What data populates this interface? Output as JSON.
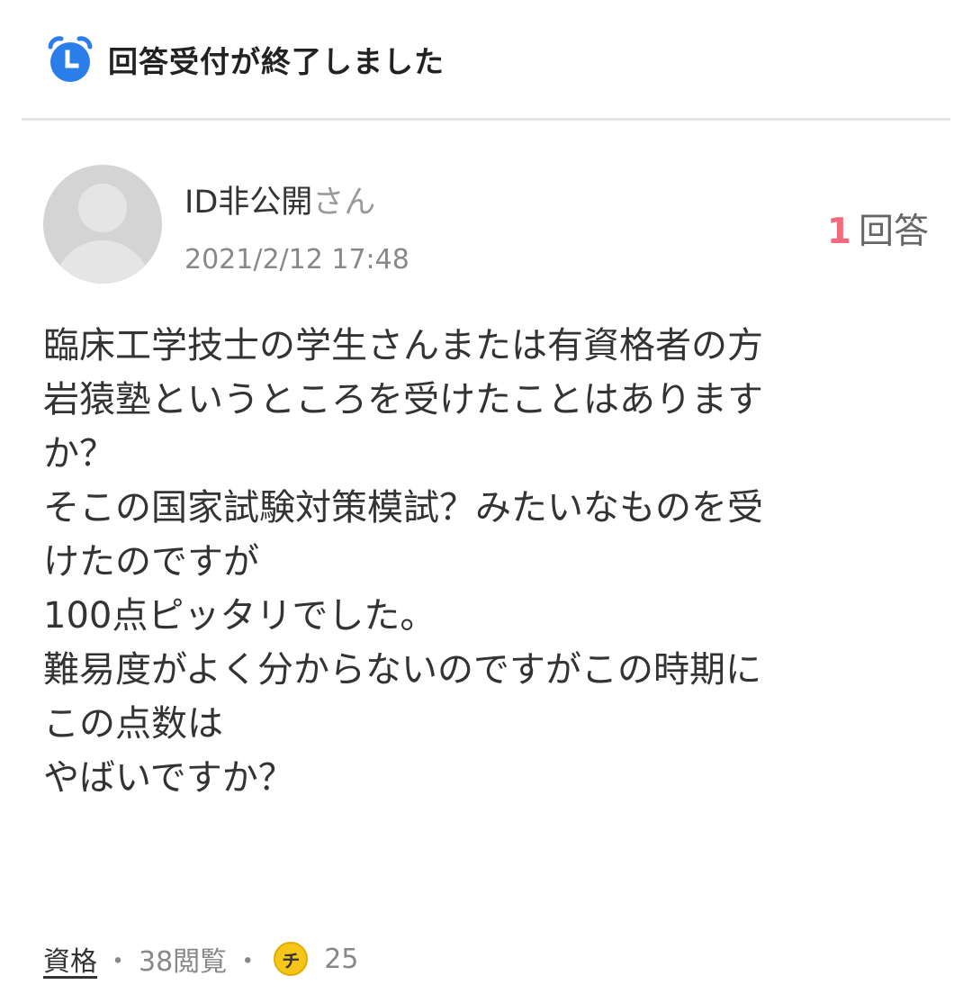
{
  "status": {
    "icon": "alarm-clock-icon",
    "text": "回答受付が終了しました",
    "accent_color": "#2b7de9"
  },
  "question": {
    "user_name": "ID非公開",
    "user_suffix": "さん",
    "date": "2021/2/12 17:48",
    "answer_count": "1",
    "answer_label": "回答",
    "answer_count_color": "#f36a7e",
    "body_lines": [
      "臨床工学技士の学生さんまたは有資格者の方",
      "岩猿塾というところを受けたことはあります",
      "か？",
      "そこの国家試験対策模試？みたいなものを受",
      "けたのですが",
      "100点ピッタリでした。",
      "難易度がよく分からないのですがこの時期に",
      "この点数は",
      "やばいですか？"
    ]
  },
  "footer": {
    "category": "資格",
    "separator": "・",
    "views": "38閲覧",
    "coin_icon": "chie-coin-icon",
    "coin_glyph": "チ",
    "coin_amount": "25"
  }
}
